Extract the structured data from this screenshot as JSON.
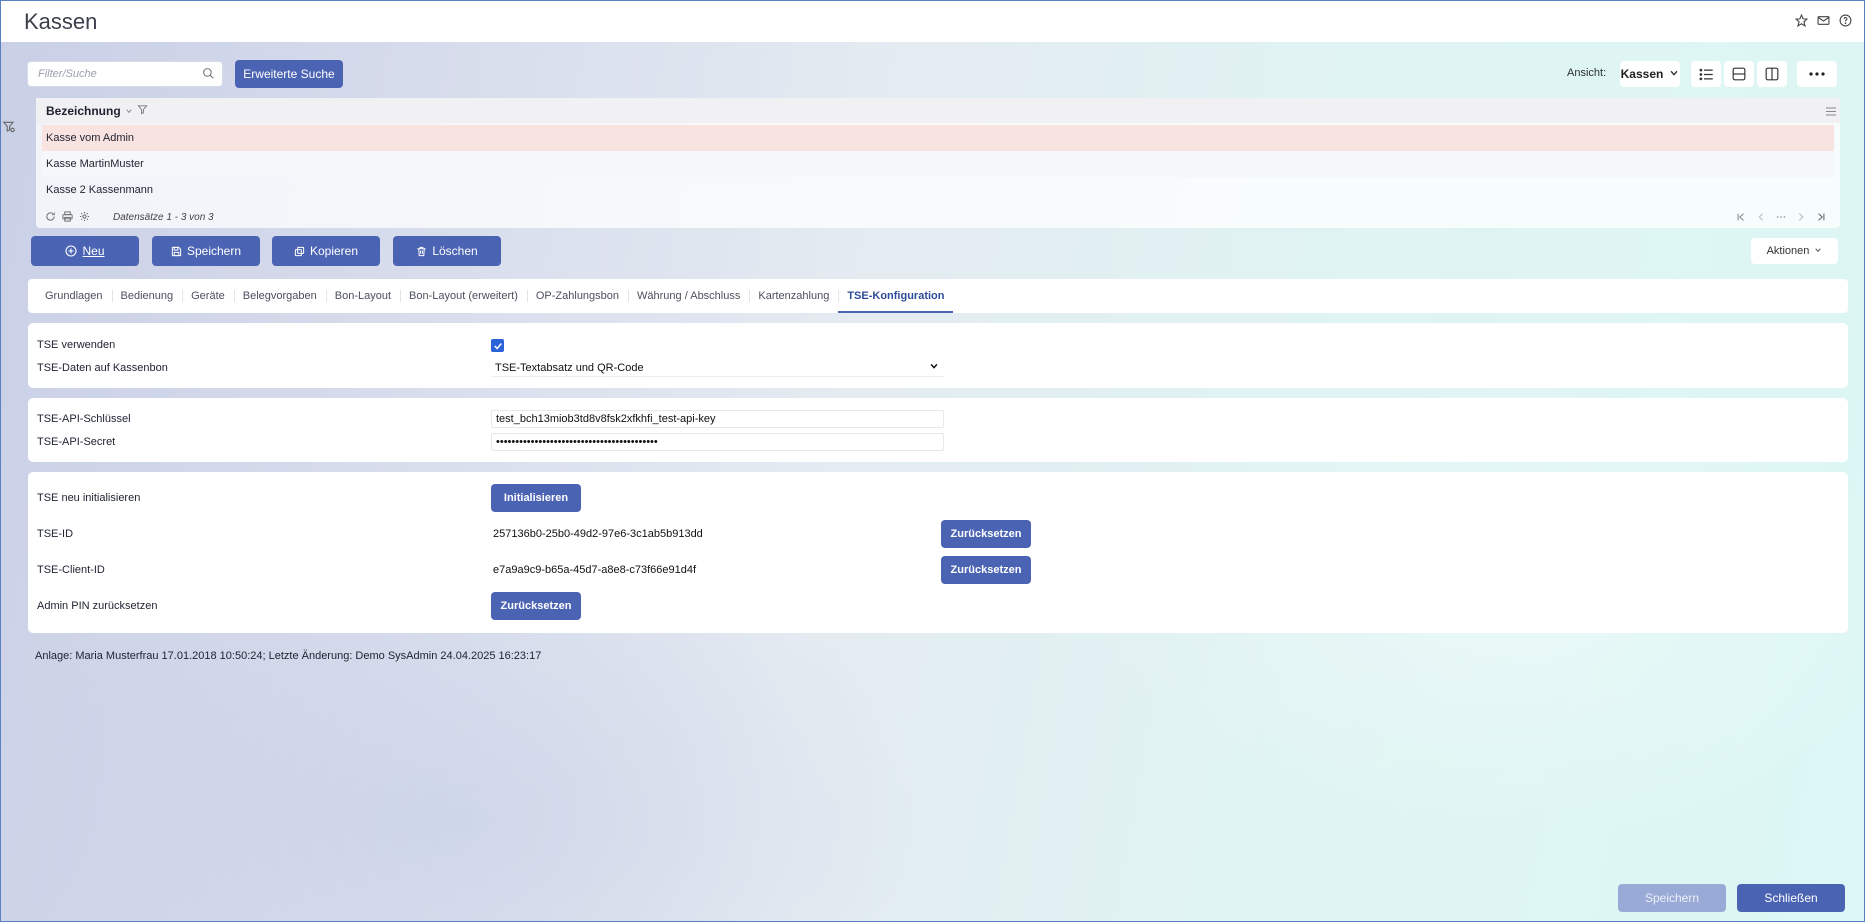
{
  "window": {
    "title": "Kassen"
  },
  "search": {
    "placeholder": "Filter/Suche",
    "extended_label": "Erweiterte Suche"
  },
  "view": {
    "label": "Ansicht:",
    "selected": "Kassen"
  },
  "grid": {
    "column": "Bezeichnung",
    "rows": [
      "Kasse vom Admin",
      "Kasse MartinMuster",
      "Kasse 2 Kassenmann"
    ],
    "selected_index": 0,
    "records_text": "Datensätze 1 - 3 von 3"
  },
  "actions": {
    "new": "Neu",
    "save": "Speichern",
    "copy": "Kopieren",
    "delete": "Löschen",
    "more": "Aktionen"
  },
  "tabs": [
    "Grundlagen",
    "Bedienung",
    "Geräte",
    "Belegvorgaben",
    "Bon-Layout",
    "Bon-Layout (erweitert)",
    "OP-Zahlungsbon",
    "Währung / Abschluss",
    "Kartenzahlung",
    "TSE-Konfiguration"
  ],
  "active_tab": "TSE-Konfiguration",
  "tse": {
    "use_label": "TSE verwenden",
    "use_checked": true,
    "receipt_label": "TSE-Daten auf Kassenbon",
    "receipt_value": "TSE-Textabsatz und QR-Code",
    "api_key_label": "TSE-API-Schlüssel",
    "api_key_value": "test_bch13miob3td8v8fsk2xfkhfi_test-api-key",
    "api_secret_label": "TSE-API-Secret",
    "api_secret_value": "••••••••••••••••••••••••••••••••••••••••••",
    "reinit_label": "TSE neu initialisieren",
    "reinit_button": "Initialisieren",
    "id_label": "TSE-ID",
    "id_value": "257136b0-25b0-49d2-97e6-3c1ab5b913dd",
    "client_id_label": "TSE-Client-ID",
    "client_id_value": "e7a9a9c9-b65a-45d7-a8e8-c73f66e91d4f",
    "reset_button": "Zurücksetzen",
    "admin_pin_label": "Admin PIN zurücksetzen"
  },
  "audit_text": "Anlage: Maria Musterfrau 17.01.2018 10:50:24; Letzte Änderung: Demo SysAdmin 24.04.2025 16:23:17",
  "footer": {
    "save": "Speichern",
    "close": "Schließen"
  },
  "colors": {
    "primary": "#4b63b3",
    "selected_row": "#f9e3e1",
    "checkbox": "#2b63d9"
  }
}
